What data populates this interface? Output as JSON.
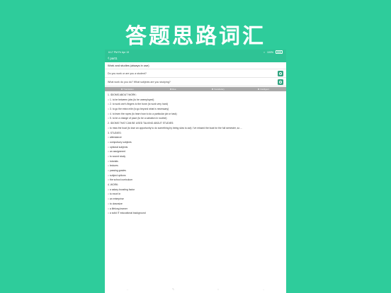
{
  "headline": "答题思路词汇",
  "status": {
    "time": "6:17 PM",
    "date": "Fri Apr 19",
    "battery": "100%"
  },
  "nav": {
    "back_label": "part1"
  },
  "section_title": "Work and studies (always in use)",
  "questions": [
    {
      "text": "Do you work or are you a student?"
    },
    {
      "text": "What work do you do? What subjects are you studying?"
    }
  ],
  "tabs": [
    {
      "label": "Translation"
    },
    {
      "label": "Idea"
    },
    {
      "label": "Vocabulary"
    },
    {
      "label": "Intelligent"
    }
  ],
  "vocab_lines": [
    "1. IDIOMS ABOUT WORK:",
    "○ 1. to be between jobs (to be unemployed)",
    "○ 2. to work one's fingers to the bone (to work very hard)",
    "○ 3. to go the extra mile (to go beyond what is necessary)",
    "○ 4. to learn the ropes (to learn how to do a particular job or task)",
    "○ 5. to be a change of pace (to be a variation in routine)",
    "2. IDIOMS THAT CAN BE USED TALKING ABOUT STUDIES:",
    "○ to miss the boat (to lose an opportunity to do something by being slow to act): I've missed the boat for the full semester, so ...",
    "3. STUDIES:",
    "○ attendance",
    "○ compulsory subjects",
    "○ optional subjects",
    "○ an assignment",
    "○ to sound study",
    "○ tutorials",
    "○ lectures",
    "○ passing grades",
    "○ subject options",
    "○ the school curriculum",
    "4. WORK:",
    "○ a salary-boosting factor",
    "○ to excel in",
    "○ an enterprise",
    "○ to downsize",
    "○ a lifelong learner",
    "○ a solid IT educational background"
  ],
  "bottom": {
    "prev": "←",
    "edit": "✎",
    "mic": "○",
    "next": "→"
  }
}
